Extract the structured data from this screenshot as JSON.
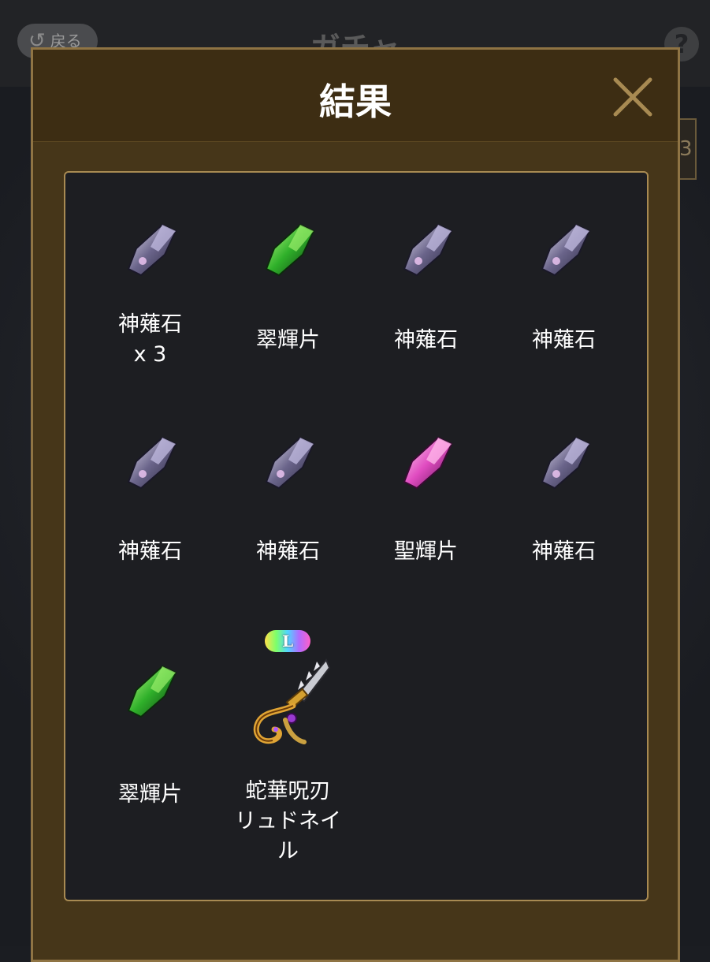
{
  "background": {
    "back_label": "戻る",
    "back_icon": "undo-icon",
    "title": "ガチャ",
    "help_icon": "question-icon",
    "side_text": "3"
  },
  "modal": {
    "title": "結果",
    "close_icon": "close-icon"
  },
  "items": [
    {
      "name": "神薙石",
      "qty": "x 3",
      "icon": "crystal-purple"
    },
    {
      "name": "翠輝片",
      "qty": "",
      "icon": "crystal-green"
    },
    {
      "name": "神薙石",
      "qty": "",
      "icon": "crystal-purple"
    },
    {
      "name": "神薙石",
      "qty": "",
      "icon": "crystal-purple"
    },
    {
      "name": "神薙石",
      "qty": "",
      "icon": "crystal-purple"
    },
    {
      "name": "神薙石",
      "qty": "",
      "icon": "crystal-purple"
    },
    {
      "name": "聖輝片",
      "qty": "",
      "icon": "crystal-pink"
    },
    {
      "name": "神薙石",
      "qty": "",
      "icon": "crystal-purple"
    },
    {
      "name": "翠輝片",
      "qty": "",
      "icon": "crystal-green"
    },
    {
      "name_lines": [
        "蛇華呪刃",
        "リュドネイ",
        "ル"
      ],
      "icon": "weapon-serpent-blade",
      "rarity": "L"
    }
  ],
  "colors": {
    "modal_bg": "#463619",
    "header_bg": "#3d2d13",
    "border_gold": "#a88a52",
    "panel_bg": "#1d1e22"
  }
}
